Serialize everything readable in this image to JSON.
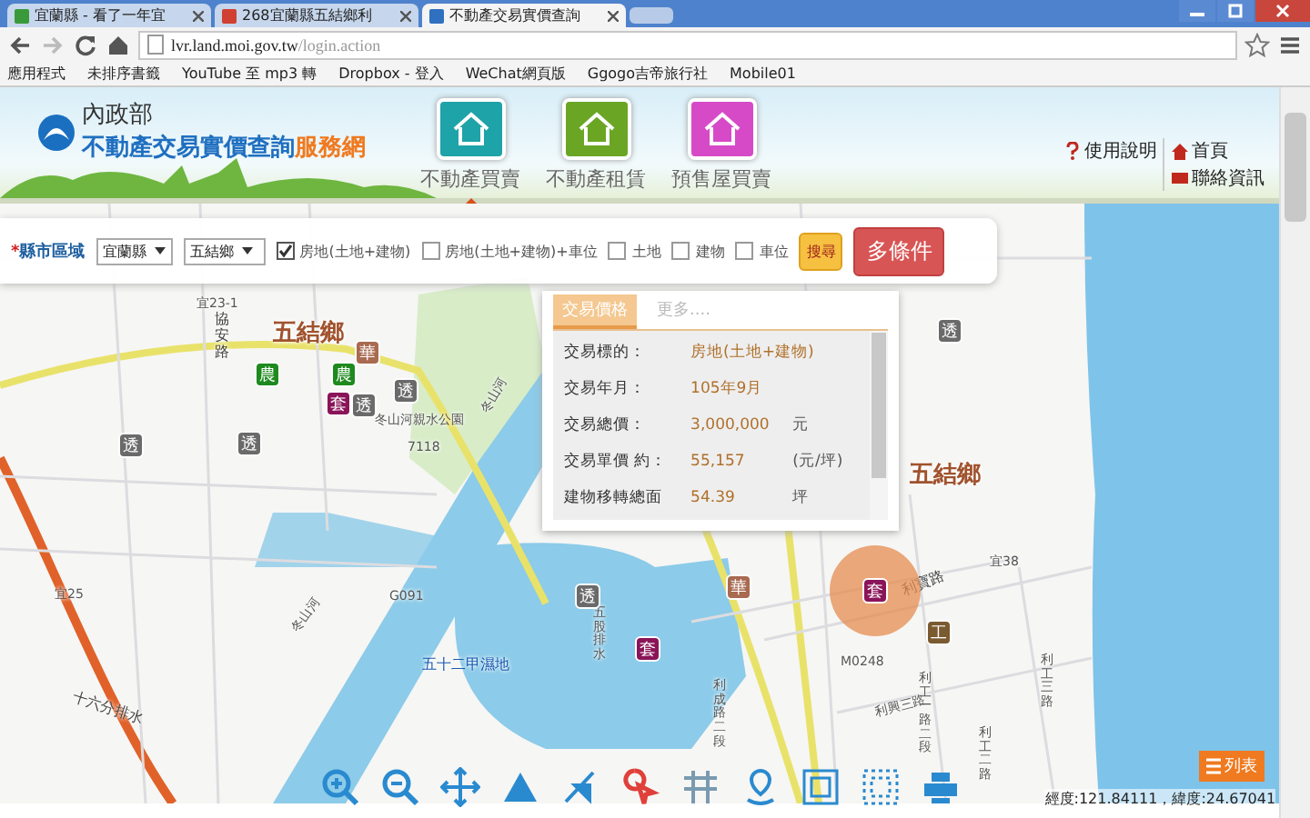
{
  "browser": {
    "tabs": [
      {
        "title": "宜蘭縣 - 看了一年宜",
        "selected": false,
        "color": "#3a9a3a"
      },
      {
        "title": "268宜蘭縣五結鄉利",
        "selected": false,
        "color": "#d04030"
      },
      {
        "title": "不動產交易實價查詢",
        "selected": true,
        "color": "#3070c0"
      }
    ],
    "url": {
      "host": "lvr.land.moi.gov.tw",
      "path": "/login.action"
    },
    "bookmarks": [
      "應用程式",
      "未排序書籤",
      "YouTube 至 mp3 轉",
      "Dropbox - 登入",
      "WeChat網頁版",
      "Ggogo吉帝旅行社",
      "Mobile01"
    ]
  },
  "header": {
    "agency": "內政部",
    "title": "不動產交易實價查詢",
    "title_suffix": "服務網",
    "nav": [
      {
        "label": "不動產買賣",
        "selected": true,
        "color": "#1ea3a8"
      },
      {
        "label": "不動產租賃",
        "selected": false,
        "color": "#6aa624"
      },
      {
        "label": "預售屋買賣",
        "selected": false,
        "color": "#d64ac8"
      }
    ],
    "links": [
      "使用說明",
      "首頁",
      "聯絡資訊"
    ]
  },
  "filter": {
    "required_mark": "*",
    "label": "縣市區域",
    "county": "宜蘭縣",
    "township": "五結鄉",
    "options": [
      {
        "label": "房地(土地+建物)",
        "checked": true
      },
      {
        "label": "房地(土地+建物)+車位",
        "checked": false
      },
      {
        "label": "土地",
        "checked": false
      },
      {
        "label": "建物",
        "checked": false
      },
      {
        "label": "車位",
        "checked": false
      }
    ],
    "search_button": "搜尋",
    "more_button": "多條件"
  },
  "popup": {
    "tabs": [
      {
        "label": "交易價格",
        "selected": true
      },
      {
        "label": "更多....",
        "selected": false
      }
    ],
    "rows": [
      {
        "label": "交易標的：",
        "value": "房地(土地+建物)"
      },
      {
        "label": "交易年月：",
        "value": "105年9月"
      },
      {
        "label": "交易總價：",
        "value": "3,000,000",
        "unit": "元"
      },
      {
        "label": "交易單價 約：",
        "value": "55,157",
        "unit": "(元/坪)"
      },
      {
        "label": "建物移轉總面",
        "value": "54.39",
        "unit": "坪"
      }
    ]
  },
  "map": {
    "places": [
      "宜23-1",
      "協安路",
      "五結鄉",
      "冬山河親水公園",
      "7118",
      "冬山河",
      "五結鄉",
      "宜25",
      "G091",
      "五十二甲濕地",
      "五股排水",
      "十六分排水",
      "利寶路",
      "宜38",
      "M0248",
      "利成路二段",
      "利興三路",
      "利工一路二段",
      "利工二路",
      "利工三路",
      "冬山河"
    ],
    "markers": [
      {
        "text": "農",
        "color": "#1e8a1e",
        "selected": false
      },
      {
        "text": "農",
        "color": "#1e8a1e",
        "selected": false
      },
      {
        "text": "華",
        "color": "#a86a50",
        "selected": false
      },
      {
        "text": "套",
        "color": "#8a1458",
        "selected": false
      },
      {
        "text": "透",
        "color": "#6a6a6a",
        "selected": false
      },
      {
        "text": "透",
        "color": "#6a6a6a",
        "selected": false
      },
      {
        "text": "透",
        "color": "#6a6a6a",
        "selected": false
      },
      {
        "text": "透",
        "color": "#6a6a6a",
        "selected": false
      },
      {
        "text": "透",
        "color": "#6a6a6a",
        "selected": false
      },
      {
        "text": "透",
        "color": "#6a6a6a",
        "selected": false
      },
      {
        "text": "套",
        "color": "#8a1458",
        "selected": false
      },
      {
        "text": "華",
        "color": "#a86a50",
        "selected": false
      },
      {
        "text": "套",
        "color": "#8a1458",
        "selected": true
      },
      {
        "text": "工",
        "color": "#7a5a30",
        "selected": false
      }
    ],
    "coordinates": "經度:121.84111，緯度:24.67041",
    "list_button": "列表"
  }
}
